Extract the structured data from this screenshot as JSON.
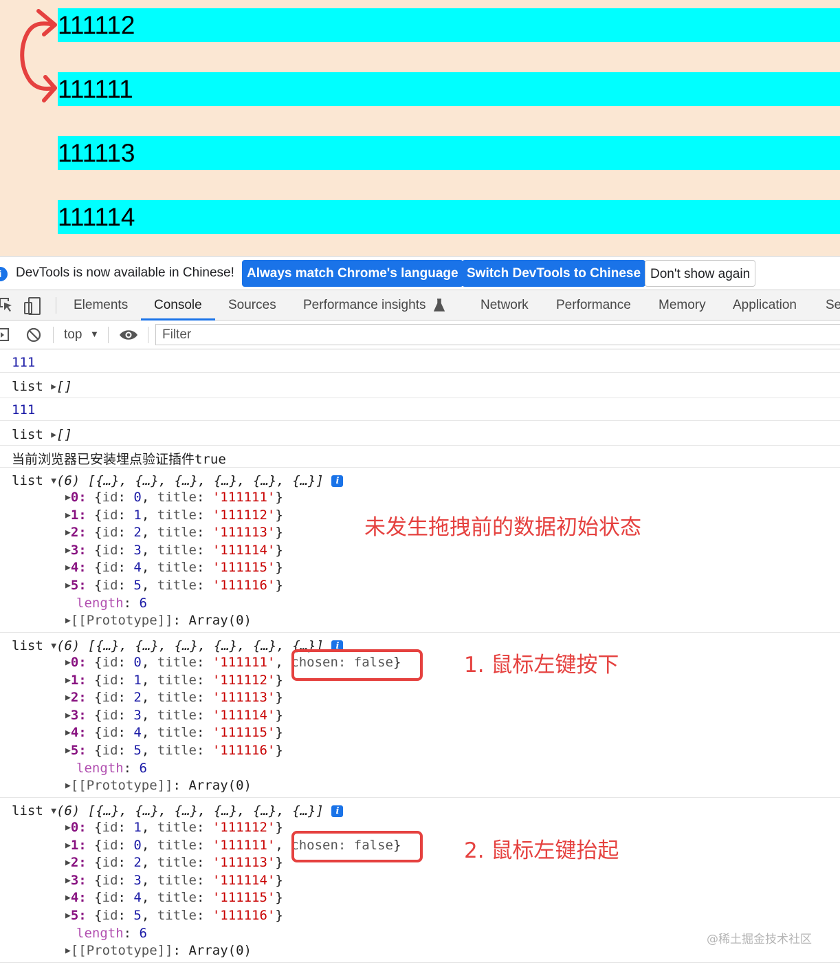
{
  "preview": {
    "items": [
      "111112",
      "111111",
      "111113",
      "111114"
    ],
    "item_color": "#00ffff",
    "background_color": "#fbe7d3",
    "annotation_arrow_color": "#e5413f"
  },
  "infobar": {
    "icon": "info-icon",
    "message": "DevTools is now available in Chinese!",
    "always_match_label": "Always match Chrome's language",
    "switch_label": "Switch DevTools to Chinese",
    "dont_show_label": "Don't show again"
  },
  "tabs": [
    {
      "label": "Elements"
    },
    {
      "label": "Console",
      "active": true
    },
    {
      "label": "Sources"
    },
    {
      "label": "Performance insights"
    },
    {
      "label": "Network"
    },
    {
      "label": "Performance"
    },
    {
      "label": "Memory"
    },
    {
      "label": "Application"
    },
    {
      "label": "Se"
    }
  ],
  "console_toolbar": {
    "context": "top",
    "filter_placeholder": "Filter"
  },
  "console": {
    "log_111": "111",
    "list_label": "list",
    "empty_array": "[]",
    "plugin_msg": "当前浏览器已安装埋点验证插件true",
    "array_summary": "(6) [{…}, {…}, {…}, {…}, {…}, {…}]",
    "badge": "i",
    "length_key": "length",
    "length_value": "6",
    "proto_key": "[[Prototype]]",
    "proto_value": "Array(0)",
    "chosen_text": "chosen: false",
    "group1": [
      {
        "index": "0",
        "id": "0",
        "title": "'111111'"
      },
      {
        "index": "1",
        "id": "1",
        "title": "'111112'"
      },
      {
        "index": "2",
        "id": "2",
        "title": "'111113'"
      },
      {
        "index": "3",
        "id": "3",
        "title": "'111114'"
      },
      {
        "index": "4",
        "id": "4",
        "title": "'111115'"
      },
      {
        "index": "5",
        "id": "5",
        "title": "'111116'"
      }
    ],
    "group2": [
      {
        "index": "0",
        "id": "0",
        "title": "'111111'"
      },
      {
        "index": "1",
        "id": "1",
        "title": "'111112'"
      },
      {
        "index": "2",
        "id": "2",
        "title": "'111113'"
      },
      {
        "index": "3",
        "id": "3",
        "title": "'111114'"
      },
      {
        "index": "4",
        "id": "4",
        "title": "'111115'"
      },
      {
        "index": "5",
        "id": "5",
        "title": "'111116'"
      }
    ],
    "group3": [
      {
        "index": "0",
        "id": "1",
        "title": "'111112'"
      },
      {
        "index": "1",
        "id": "0",
        "title": "'111111'"
      },
      {
        "index": "2",
        "id": "2",
        "title": "'111113'"
      },
      {
        "index": "3",
        "id": "3",
        "title": "'111114'"
      },
      {
        "index": "4",
        "id": "4",
        "title": "'111115'"
      },
      {
        "index": "5",
        "id": "5",
        "title": "'111116'"
      }
    ]
  },
  "annotations": {
    "initial_state": "未发生拖拽前的数据初始状态",
    "mouse_down": "1. 鼠标左键按下",
    "mouse_up": "2. 鼠标左键抬起",
    "color": "#e5413f"
  },
  "watermark": "@稀土掘金技术社区"
}
